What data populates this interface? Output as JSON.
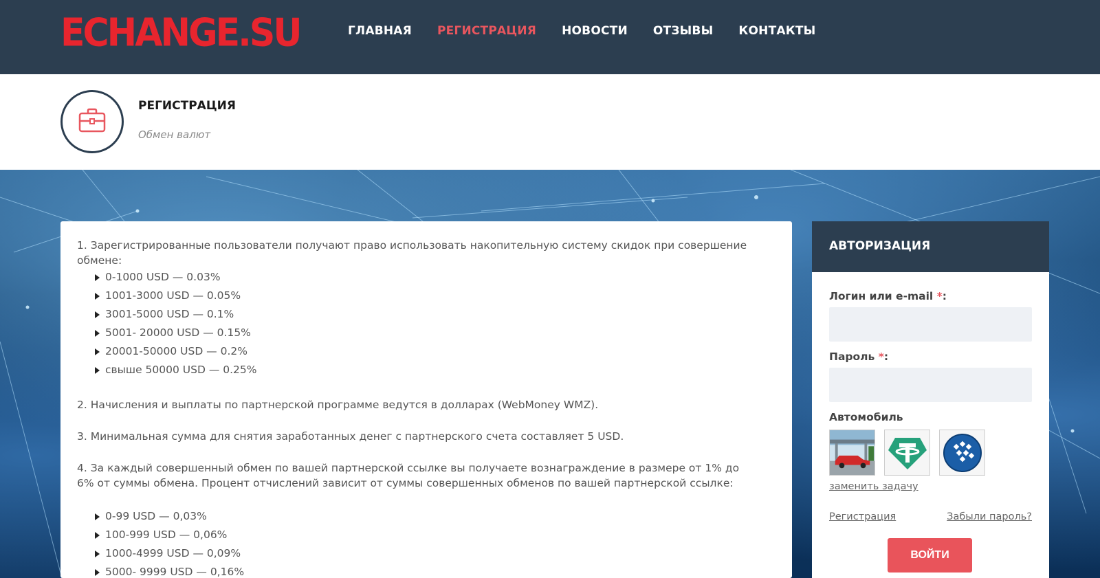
{
  "header": {
    "logo_text": "ECHANGE.SU",
    "nav": [
      {
        "label": "ГЛАВНАЯ",
        "active": false
      },
      {
        "label": "РЕГИСТРАЦИЯ",
        "active": true
      },
      {
        "label": "НОВОСТИ",
        "active": false
      },
      {
        "label": "ОТЗЫВЫ",
        "active": false
      },
      {
        "label": "КОНТАКТЫ",
        "active": false
      }
    ]
  },
  "page": {
    "title": "РЕГИСТРАЦИЯ",
    "subtitle": "Обмен валют",
    "icon": "briefcase-icon"
  },
  "content": {
    "p1": "1. Зарегистрированные пользователи получают право использовать накопительную систему скидок при совершение обмене:",
    "discounts": [
      "0-1000 USD — 0.03%",
      "1001-3000 USD — 0.05%",
      "3001-5000 USD — 0.1%",
      "5001- 20000 USD — 0.15%",
      "20001-50000 USD — 0.2%",
      "свыше 50000 USD — 0.25%"
    ],
    "p2": "2. Начисления и выплаты по партнерской программе ведутся в долларах (WebMoney WMZ).",
    "p3": "3. Минимальная сумма для снятия заработанных денег с партнерского счета составляет 5 USD.",
    "p4": "4. За каждый совершенный обмен по вашей партнерской ссылке вы получаете вознаграждение в размере от 1% до 6% от суммы обмена. Процент отчислений зависит от суммы совершенных обменов по вашей партнерской ссылке:",
    "partner_rates": [
      "0-99 USD — 0,03%",
      "100-999 USD — 0,06%",
      "1000-4999 USD — 0,09%",
      "5000- 9999 USD — 0,16%"
    ]
  },
  "auth": {
    "title": "АВТОРИЗАЦИЯ",
    "login_label": "Логин или e-mail",
    "password_label": "Пароль",
    "required_mark": "*",
    "colon": ":",
    "captcha_label": "Автомобиль",
    "captcha_images": [
      "car-image",
      "tether-icon",
      "webmoney-icon"
    ],
    "change_task": "заменить задачу",
    "register_link": "Регистрация",
    "forgot_link": "Забыли пароль?",
    "submit": "ВОЙТИ"
  },
  "colors": {
    "header_bg": "#2c3e50",
    "accent": "#e8565e",
    "logo": "#e8252e",
    "input_bg": "#eef1f5"
  }
}
